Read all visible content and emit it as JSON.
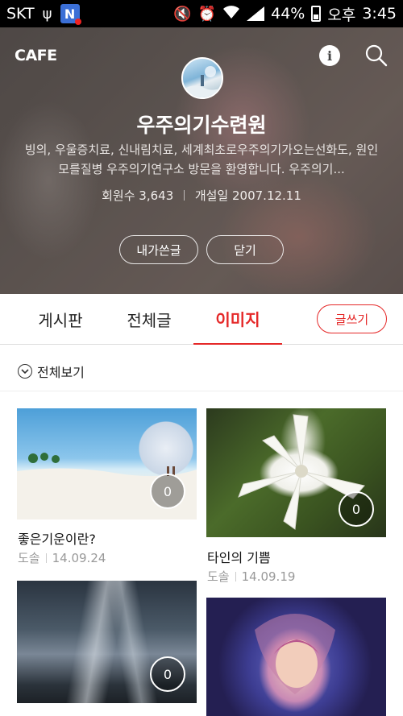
{
  "status_bar": {
    "carrier": "SKT",
    "notification_badge": "N",
    "battery": "44%",
    "ampm": "오후",
    "time": "3:45"
  },
  "header": {
    "logo": "CAFE",
    "title": "우주의기수련원",
    "description": "빙의, 우울증치료, 신내림치료, 세계최초로우주의기가오는선화도, 원인모를질병 우주의기연구소 방문을 환영합니다. 우주의기...",
    "members_label": "회원수",
    "members_count": "3,643",
    "opened_label": "개설일",
    "opened_date": "2007.12.11",
    "my_posts_button": "내가쓴글",
    "close_button": "닫기"
  },
  "tabs": [
    {
      "label": "게시판",
      "active": false
    },
    {
      "label": "전체글",
      "active": false
    },
    {
      "label": "이미지",
      "active": true
    }
  ],
  "write_button": "글쓰기",
  "filter_label": "전체보기",
  "posts": [
    {
      "title": "좋은기운이란?",
      "author": "도솔",
      "date": "14.09.24",
      "comments": "0"
    },
    {
      "title": "타인의 기쁨",
      "author": "도솔",
      "date": "14.09.19",
      "comments": "0"
    },
    {
      "title": "",
      "author": "",
      "date": "",
      "comments": "0"
    },
    {
      "title": "",
      "author": "",
      "date": "",
      "comments": ""
    }
  ],
  "colors": {
    "accent": "#e52828",
    "status_bar": "#000000"
  }
}
